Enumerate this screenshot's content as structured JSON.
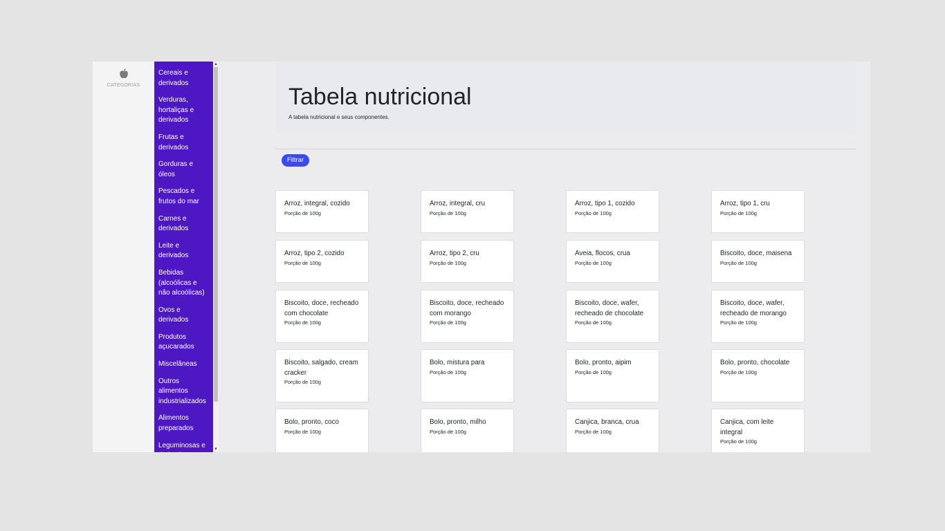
{
  "rail": {
    "logo_icon": "apple-icon",
    "label": "CATEGORIAS"
  },
  "categories": [
    "Cereais e derivados",
    "Verduras, hortaliças e derivados",
    "Frutas e derivados",
    "Gorduras e óleos",
    "Pescados e frutos do mar",
    "Carnes e derivados",
    "Leite e derivados",
    "Bebidas (alcoólicas e não alcoólicas)",
    "Ovos e derivados",
    "Produtos açucarados",
    "Miscelâneas",
    "Outros alimentos industrializados",
    "Alimentos preparados",
    "Leguminosas e derivados"
  ],
  "header": {
    "title": "Tabela nutricional",
    "subtitle": "A tabela nutricional e seus componentes."
  },
  "filter_label": "Filtrar",
  "portion_label": "Porção de 100g",
  "foods": [
    [
      "Arroz, integral, cozido",
      "Arroz, integral, cru",
      "Arroz, tipo 1, cozido",
      "Arroz, tipo 1, cru"
    ],
    [
      "Arroz, tipo 2, cozido",
      "Arroz, tipo 2, cru",
      "Aveia, flocos, crua",
      "Biscoito, doce, maisena"
    ],
    [
      "Biscoito, doce, recheado com chocolate",
      "Biscoito, doce, recheado com morango",
      "Biscoito, doce, wafer, recheado de chocolate",
      "Biscoito, doce, wafer, recheado de morango"
    ],
    [
      "Biscoito, salgado, cream cracker",
      "Bolo, mistura para",
      "Bolo, pronto, aipim",
      "Bolo, pronto, chocolate"
    ],
    [
      "Bolo, pronto, coco",
      "Bolo, pronto, milho",
      "Canjica, branca, crua",
      "Canjica, com leite integral"
    ]
  ],
  "colors": {
    "category_bg": "#4d17c3",
    "filter_button": "#3b49ef",
    "header_bg": "#e8eaed",
    "page_bg": "#ececee"
  }
}
